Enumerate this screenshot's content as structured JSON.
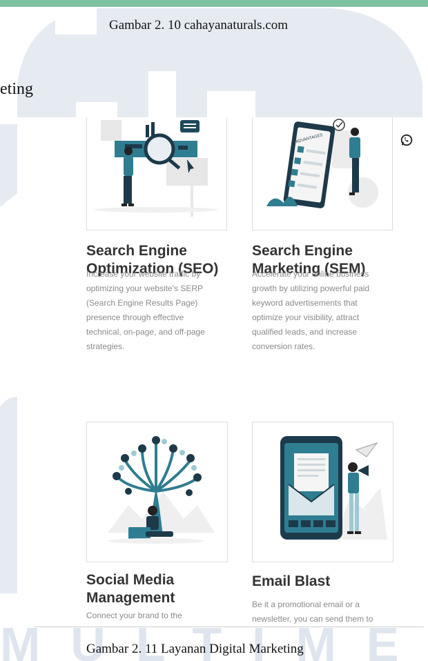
{
  "captions": {
    "top": "Gambar 2. 10 cahayanaturals.com",
    "bottom": "Gambar 2. 11 Layanan Digital Marketing"
  },
  "body_fragment": "eting",
  "services": [
    {
      "title_line1": "Search Engine",
      "title_line2": "Optimization (SEO)",
      "description": [
        "Increase your website traffic by",
        "optimizing your website's SERP",
        "(Search Engine Results Page)",
        "presence through effective",
        "technical, on-page, and off-page",
        "strategies."
      ]
    },
    {
      "title_line1": "Search Engine",
      "title_line2": "Marketing (SEM)",
      "description": [
        "Accelerate your online business",
        "growth by utilizing powerful paid",
        "keyword advertisements that",
        "optimize your visibility, attract",
        "qualified leads, and increase",
        "conversion rates."
      ]
    },
    {
      "title_line1": "Social Media",
      "title_line2": "Management",
      "description": [
        "Connect your brand to the"
      ]
    },
    {
      "title_line1": "Email Blast",
      "title_line2": "",
      "description": [
        "Be it a promotional email or a",
        "newsletter, you can send them to"
      ]
    }
  ],
  "illustration_labels": {
    "advantages": "ADVANTAGES"
  },
  "watermark": {
    "text": "MULTIMEDIA",
    "color": "#dfe5ee"
  },
  "icons": [
    "whatsapp-icon"
  ]
}
